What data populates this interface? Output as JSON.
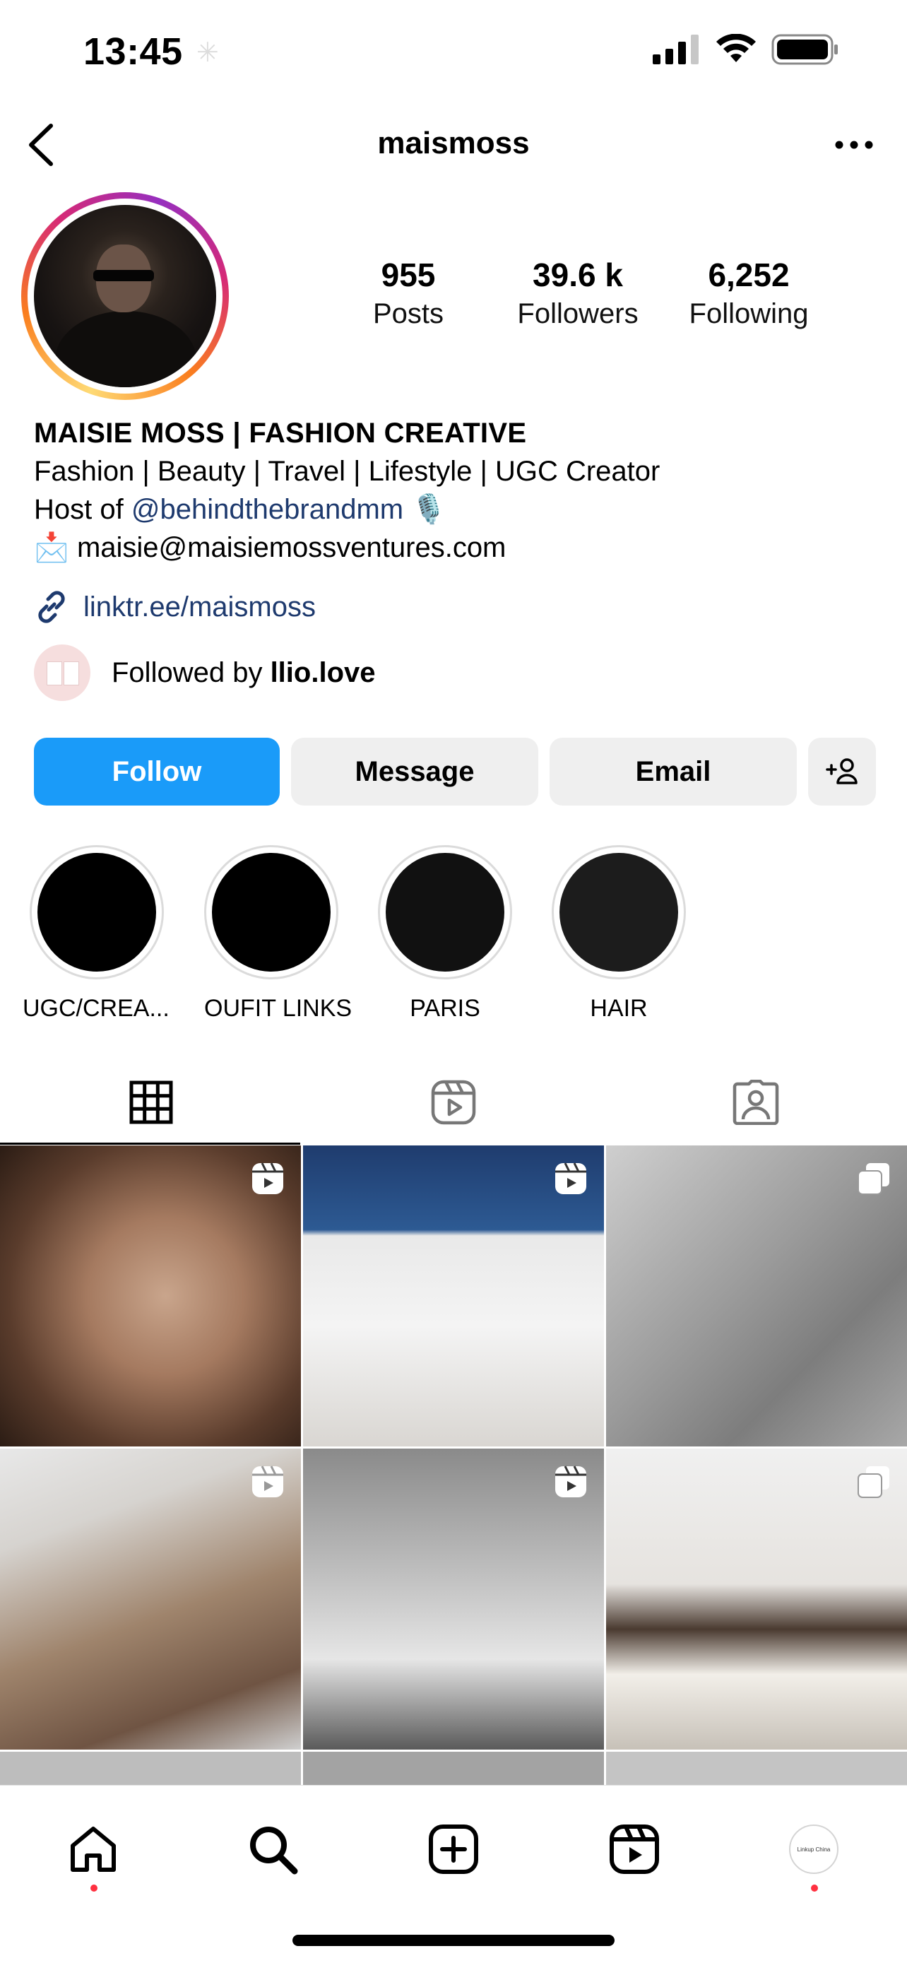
{
  "status_bar": {
    "time": "13:45",
    "dim_glyph": "✳"
  },
  "header": {
    "username": "maismoss"
  },
  "stats": [
    {
      "value": "955",
      "label": "Posts"
    },
    {
      "value": "39.6 k",
      "label": "Followers"
    },
    {
      "value": "6,252",
      "label": "Following"
    }
  ],
  "bio": {
    "name": "MAISIE MOSS | FASHION CREATIVE",
    "line1": "Fashion | Beauty | Travel | Lifestyle | UGC Creator",
    "host_prefix": "Host of ",
    "mention": "@behindthebrandmm",
    "mic_emoji": "🎙️",
    "mail_emoji": "📩",
    "email": "maisie@maisiemossventures.com",
    "link": "linktr.ee/maismoss",
    "followed_prefix": "Followed by ",
    "followed_by": "llio.love"
  },
  "actions": {
    "follow": "Follow",
    "message": "Message",
    "email": "Email"
  },
  "highlights": [
    {
      "label": "UGC/CREA...",
      "color": "#000000"
    },
    {
      "label": "OUFIT LINKS",
      "color": "#000000"
    },
    {
      "label": "PARIS",
      "color": "#111111"
    },
    {
      "label": "HAIR",
      "color": "#1c1c1c"
    }
  ],
  "bottom_nav": {
    "profile_thumb_text": "Linkup China"
  },
  "colors": {
    "accent": "#1a9bf9",
    "link": "#1e3a6e",
    "badge_red": "#ff3040"
  }
}
